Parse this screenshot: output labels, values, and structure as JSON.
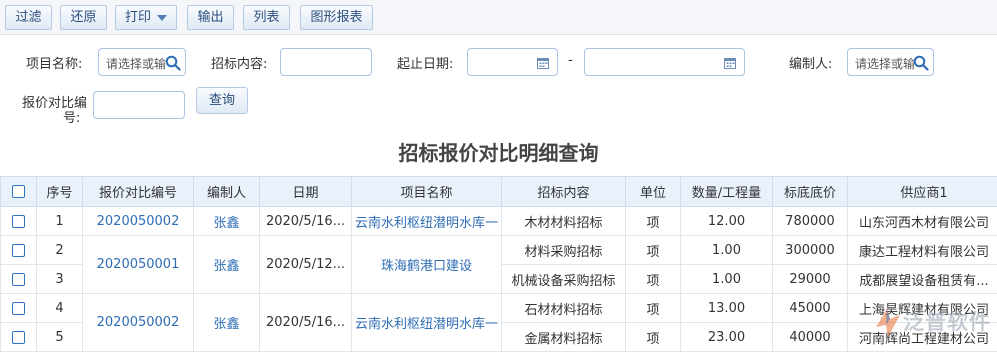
{
  "toolbar": {
    "filter": "过滤",
    "restore": "还原",
    "print": "打印",
    "export": "输出",
    "list": "列表",
    "chart_report": "图形报表"
  },
  "search": {
    "project_name_label": "项目名称:",
    "project_name_placeholder": "请选择或输",
    "bid_content_label": "招标内容:",
    "date_range_label": "起止日期:",
    "date_separator": "-",
    "editor_label": "编制人:",
    "editor_placeholder": "请选择或输",
    "quote_no_label_line1": "报价对比编",
    "quote_no_label_line2": "号:",
    "query_button": "查询"
  },
  "report_title": "招标报价对比明细查询",
  "table": {
    "headers": [
      "序号",
      "报价对比编号",
      "编制人",
      "日期",
      "项目名称",
      "招标内容",
      "单位",
      "数量/工程量",
      "标底底价",
      "供应商1"
    ],
    "rows": [
      {
        "seq": "1",
        "quote_no": "2020050002",
        "editor": "张鑫",
        "date": "2020/5/16...",
        "project": "云南水利枢纽潜明水库一",
        "content": "木材材料招标",
        "unit": "项",
        "qty": "12.00",
        "price": "780000",
        "supplier": "山东河西木材有限公司"
      },
      {
        "seq": "2",
        "quote_no": "2020050001",
        "editor": "张鑫",
        "date": "2020/5/12...",
        "project": "珠海鹤港口建设",
        "content": "材料采购招标",
        "unit": "项",
        "qty": "1.00",
        "price": "300000",
        "supplier": "康达工程材料有限公司"
      },
      {
        "seq": "3",
        "content": "机械设备采购招标",
        "unit": "项",
        "qty": "1.00",
        "price": "29000",
        "supplier": "成都展望设备租赁有..."
      },
      {
        "seq": "4",
        "quote_no": "2020050002",
        "editor": "张鑫",
        "date": "2020/5/16...",
        "project": "云南水利枢纽潜明水库一",
        "content": "石材材料招标",
        "unit": "项",
        "qty": "13.00",
        "price": "45000",
        "supplier": "上海昊辉建材有限公司"
      },
      {
        "seq": "5",
        "content": "金属材料招标",
        "unit": "项",
        "qty": "23.00",
        "price": "40000",
        "supplier": "河南辉尚工程建材公司"
      }
    ]
  },
  "watermark": "泛普软件",
  "colors": {
    "accent": "#2f6db5",
    "header_bg": "#e9f1fb",
    "border": "#a9c3e2"
  }
}
